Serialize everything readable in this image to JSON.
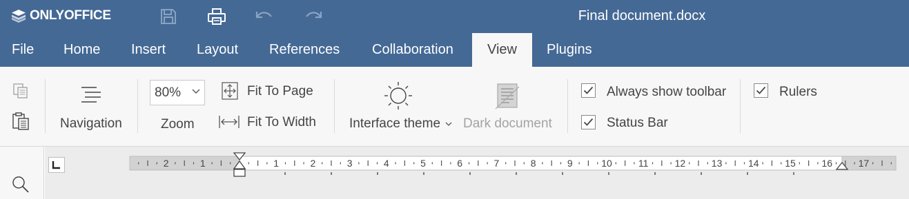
{
  "app": {
    "logo_text": "ONLYOFFICE",
    "doc_title": "Final document.docx"
  },
  "quick_access": {
    "icons": [
      "save-icon",
      "print-icon",
      "undo-icon",
      "redo-icon"
    ]
  },
  "tabs": [
    {
      "label": "File",
      "active": false
    },
    {
      "label": "Home",
      "active": false
    },
    {
      "label": "Insert",
      "active": false
    },
    {
      "label": "Layout",
      "active": false
    },
    {
      "label": "References",
      "active": false
    },
    {
      "label": "Collaboration",
      "active": false
    },
    {
      "label": "View",
      "active": true
    },
    {
      "label": "Plugins",
      "active": false
    }
  ],
  "toolbar": {
    "navigation_label": "Navigation",
    "zoom_value": "80%",
    "zoom_label": "Zoom",
    "fit_page_label": "Fit To Page",
    "fit_width_label": "Fit To Width",
    "interface_theme_label": "Interface theme",
    "dark_document_label": "Dark document",
    "always_show_toolbar": {
      "label": "Always show toolbar",
      "checked": true
    },
    "status_bar": {
      "label": "Status Bar",
      "checked": true
    },
    "rulers": {
      "label": "Rulers",
      "checked": true
    }
  },
  "ruler": {
    "left_numbers": [
      "2",
      "1"
    ],
    "right_numbers": [
      "1",
      "2",
      "3",
      "4",
      "5",
      "6",
      "7",
      "8",
      "9",
      "10",
      "11",
      "12",
      "13",
      "14",
      "15",
      "16",
      "17"
    ]
  },
  "colors": {
    "header_bg": "#446995",
    "toolbar_bg": "#f7f7f7",
    "ruler_bg": "#ececec"
  }
}
